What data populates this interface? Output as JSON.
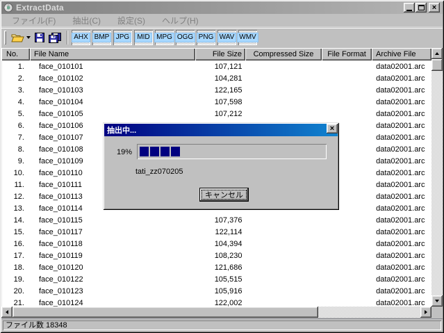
{
  "window": {
    "title": "ExtractData"
  },
  "menu": {
    "items": [
      {
        "label": "ファイル(F)"
      },
      {
        "label": "抽出(C)"
      },
      {
        "label": "設定(S)"
      },
      {
        "label": "ヘルプ(H)"
      }
    ]
  },
  "toolbar": {
    "icons": [
      {
        "name": "open-folder-icon"
      },
      {
        "name": "chevron-down-icon"
      },
      {
        "name": "save-floppy-icon"
      },
      {
        "name": "save-all-icon"
      }
    ],
    "format_buttons": [
      "AHX",
      "BMP",
      "JPG",
      "MID",
      "MPG",
      "OGG",
      "PNG",
      "WAV",
      "WMV"
    ]
  },
  "table": {
    "columns": [
      "No.",
      "File Name",
      "File Size",
      "Compressed Size",
      "File Format",
      "Archive File"
    ],
    "rows": [
      {
        "no": "1.",
        "name": "face_010101",
        "size": "107,121",
        "compressed": "",
        "format": "",
        "archive": "data02001.arc"
      },
      {
        "no": "2.",
        "name": "face_010102",
        "size": "104,281",
        "compressed": "",
        "format": "",
        "archive": "data02001.arc"
      },
      {
        "no": "3.",
        "name": "face_010103",
        "size": "122,165",
        "compressed": "",
        "format": "",
        "archive": "data02001.arc"
      },
      {
        "no": "4.",
        "name": "face_010104",
        "size": "107,598",
        "compressed": "",
        "format": "",
        "archive": "data02001.arc"
      },
      {
        "no": "5.",
        "name": "face_010105",
        "size": "107,212",
        "compressed": "",
        "format": "",
        "archive": "data02001.arc"
      },
      {
        "no": "6.",
        "name": "face_010106",
        "size": "",
        "compressed": "",
        "format": "",
        "archive": "data02001.arc"
      },
      {
        "no": "7.",
        "name": "face_010107",
        "size": "",
        "compressed": "",
        "format": "",
        "archive": "data02001.arc"
      },
      {
        "no": "8.",
        "name": "face_010108",
        "size": "",
        "compressed": "",
        "format": "",
        "archive": "data02001.arc"
      },
      {
        "no": "9.",
        "name": "face_010109",
        "size": "",
        "compressed": "",
        "format": "",
        "archive": "data02001.arc"
      },
      {
        "no": "10.",
        "name": "face_010110",
        "size": "",
        "compressed": "",
        "format": "",
        "archive": "data02001.arc"
      },
      {
        "no": "11.",
        "name": "face_010111",
        "size": "",
        "compressed": "",
        "format": "",
        "archive": "data02001.arc"
      },
      {
        "no": "12.",
        "name": "face_010113",
        "size": "",
        "compressed": "",
        "format": "",
        "archive": "data02001.arc"
      },
      {
        "no": "13.",
        "name": "face_010114",
        "size": "",
        "compressed": "",
        "format": "",
        "archive": "data02001.arc"
      },
      {
        "no": "14.",
        "name": "face_010115",
        "size": "107,376",
        "compressed": "",
        "format": "",
        "archive": "data02001.arc"
      },
      {
        "no": "15.",
        "name": "face_010117",
        "size": "122,114",
        "compressed": "",
        "format": "",
        "archive": "data02001.arc"
      },
      {
        "no": "16.",
        "name": "face_010118",
        "size": "104,394",
        "compressed": "",
        "format": "",
        "archive": "data02001.arc"
      },
      {
        "no": "17.",
        "name": "face_010119",
        "size": "108,230",
        "compressed": "",
        "format": "",
        "archive": "data02001.arc"
      },
      {
        "no": "18.",
        "name": "face_010120",
        "size": "121,686",
        "compressed": "",
        "format": "",
        "archive": "data02001.arc"
      },
      {
        "no": "19.",
        "name": "face_010122",
        "size": "105,515",
        "compressed": "",
        "format": "",
        "archive": "data02001.arc"
      },
      {
        "no": "20.",
        "name": "face_010123",
        "size": "105,916",
        "compressed": "",
        "format": "",
        "archive": "data02001.arc"
      },
      {
        "no": "21.",
        "name": "face_010124",
        "size": "122,002",
        "compressed": "",
        "format": "",
        "archive": "data02001.arc"
      }
    ]
  },
  "dialog": {
    "title": "抽出中...",
    "percent": "19%",
    "segments": 4,
    "current_file": "tati_zz070205",
    "cancel_label": "キャンセル"
  },
  "status_bar": {
    "text": "ファイル数 18348"
  },
  "colors": {
    "accent_navy": "#000080",
    "dialog_title_gradient_end": "#1084d0",
    "inactive_title_start": "#7f7f7f",
    "inactive_title_end": "#b5b5b5",
    "format_button_bg": "#a8d8ff",
    "base_gray": "#c0c0c0"
  }
}
